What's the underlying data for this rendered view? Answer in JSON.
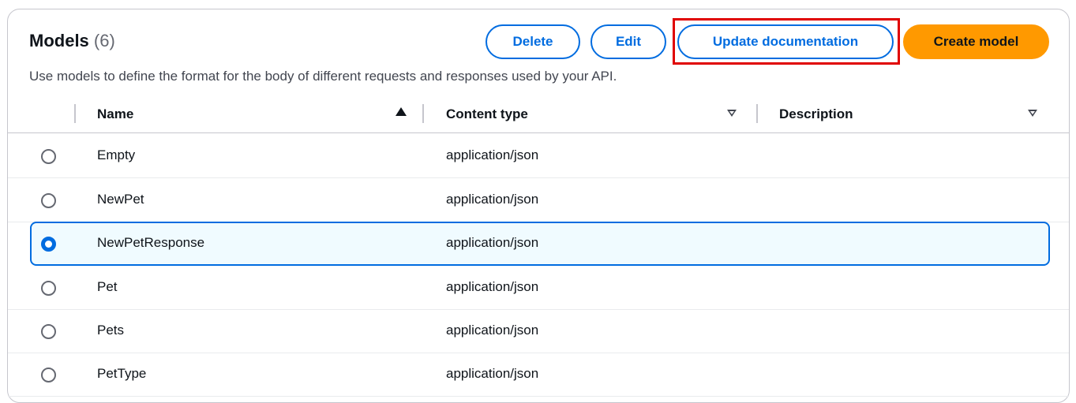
{
  "header": {
    "title": "Models",
    "count": "(6)",
    "description": "Use models to define the format for the body of different requests and responses used by your API."
  },
  "actions": {
    "delete": "Delete",
    "edit": "Edit",
    "update_documentation": "Update documentation",
    "create_model": "Create model"
  },
  "columns": {
    "name": "Name",
    "content_type": "Content type",
    "description": "Description"
  },
  "rows": [
    {
      "name": "Empty",
      "content_type": "application/json",
      "selected": false
    },
    {
      "name": "NewPet",
      "content_type": "application/json",
      "selected": false
    },
    {
      "name": "NewPetResponse",
      "content_type": "application/json",
      "selected": true
    },
    {
      "name": "Pet",
      "content_type": "application/json",
      "selected": false
    },
    {
      "name": "Pets",
      "content_type": "application/json",
      "selected": false
    },
    {
      "name": "PetType",
      "content_type": "application/json",
      "selected": false
    }
  ],
  "colors": {
    "accent": "#006ce0",
    "primary": "#ff9900",
    "highlight": "#e00000"
  }
}
